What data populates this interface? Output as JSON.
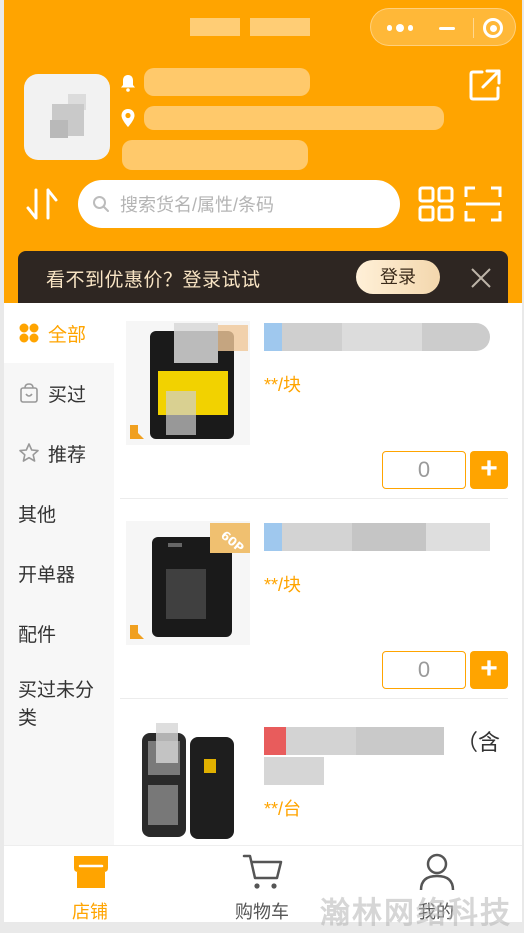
{
  "window": {
    "capsule": {
      "more_icon": "more-dots-icon",
      "minimize_icon": "minimize-icon",
      "close_icon": "target-close-icon"
    }
  },
  "header": {
    "search_placeholder": "搜索货名/属性/条码",
    "icons": [
      "bell-icon",
      "location-pin-icon",
      "share-icon",
      "sort-icon",
      "grid-view-icon",
      "scan-icon"
    ]
  },
  "promo": {
    "text": "看不到优惠价？登录试试",
    "login_label": "登录"
  },
  "sidebar": {
    "items": [
      {
        "label": "全部",
        "icon": "all-icon",
        "active": true
      },
      {
        "label": "买过",
        "icon": "bag-icon",
        "active": false
      },
      {
        "label": "推荐",
        "icon": "star-icon",
        "active": false
      },
      {
        "label": "其他",
        "active": false
      },
      {
        "label": "开单器",
        "active": false
      },
      {
        "label": "配件",
        "active": false
      },
      {
        "label": "买过未分类",
        "active": false
      }
    ]
  },
  "products": [
    {
      "price": "**/块",
      "quantity": "0",
      "add_label": "+"
    },
    {
      "price": "**/块",
      "quantity": "0",
      "add_label": "+",
      "badge": "60P"
    },
    {
      "price": "**/台",
      "title_suffix": "（含"
    }
  ],
  "tabs": [
    {
      "label": "店铺",
      "icon": "store-icon",
      "active": true
    },
    {
      "label": "购物车",
      "icon": "cart-icon",
      "active": false
    },
    {
      "label": "我的",
      "icon": "user-icon",
      "active": false
    }
  ],
  "watermark": "瀚林网络科技",
  "colors": {
    "brand": "#FFA400",
    "promo_bg": "#2E2622",
    "promo_text": "#F8E4C4"
  }
}
